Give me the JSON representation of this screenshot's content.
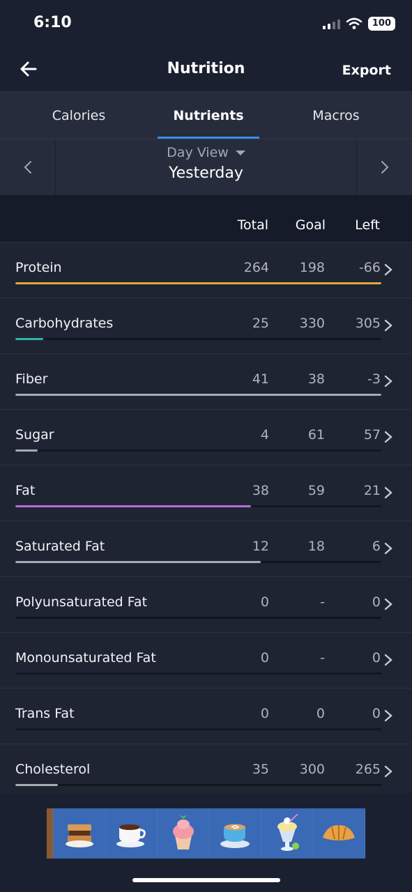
{
  "status": {
    "time": "6:10",
    "battery": "100"
  },
  "header": {
    "title": "Nutrition",
    "export_label": "Export"
  },
  "tabs": [
    {
      "label": "Calories",
      "active": false
    },
    {
      "label": "Nutrients",
      "active": true
    },
    {
      "label": "Macros",
      "active": false
    }
  ],
  "day": {
    "mode": "Day View",
    "label": "Yesterday"
  },
  "columns": {
    "total": "Total",
    "goal": "Goal",
    "left": "Left"
  },
  "rows": [
    {
      "name": "Protein",
      "total": "264",
      "goal": "198",
      "left": "-66",
      "progress": 1.0,
      "color": "#e5a93a"
    },
    {
      "name": "Carbohydrates",
      "total": "25",
      "goal": "330",
      "left": "305",
      "progress": 0.076,
      "color": "#2fb3a9"
    },
    {
      "name": "Fiber",
      "total": "41",
      "goal": "38",
      "left": "-3",
      "progress": 1.0,
      "color": "#a7abb3"
    },
    {
      "name": "Sugar",
      "total": "4",
      "goal": "61",
      "left": "57",
      "progress": 0.06,
      "color": "#a7abb3"
    },
    {
      "name": "Fat",
      "total": "38",
      "goal": "59",
      "left": "21",
      "progress": 0.644,
      "color": "#b86fd8"
    },
    {
      "name": "Saturated Fat",
      "total": "12",
      "goal": "18",
      "left": "6",
      "progress": 0.67,
      "color": "#a7abb3"
    },
    {
      "name": "Polyunsaturated Fat",
      "total": "0",
      "goal": "-",
      "left": "0",
      "progress": 0,
      "color": "#a7abb3"
    },
    {
      "name": "Monounsaturated Fat",
      "total": "0",
      "goal": "-",
      "left": "0",
      "progress": 0,
      "color": "#a7abb3"
    },
    {
      "name": "Trans Fat",
      "total": "0",
      "goal": "0",
      "left": "0",
      "progress": 0,
      "color": "#a7abb3"
    },
    {
      "name": "Cholesterol",
      "total": "35",
      "goal": "300",
      "left": "265",
      "progress": 0.117,
      "color": "#a7abb3"
    }
  ],
  "ad": {
    "items": [
      "smores-icon",
      "coffee-cup-icon",
      "cupcake-icon",
      "latte-icon",
      "sundae-drink-icon",
      "croissant-icon"
    ]
  }
}
